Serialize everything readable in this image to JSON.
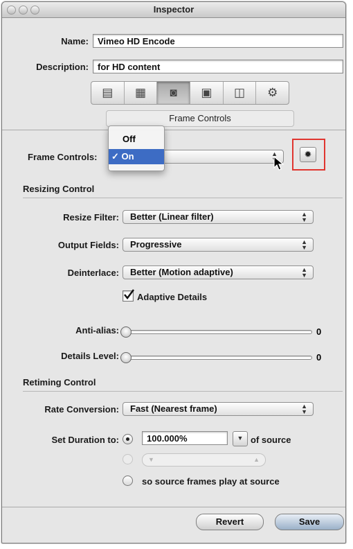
{
  "window": {
    "title": "Inspector"
  },
  "header": {
    "name_label": "Name:",
    "name_value": "Vimeo HD Encode",
    "description_label": "Description:",
    "description_value": "for HD content"
  },
  "toolbar": {
    "tabs": [
      {
        "icon": "summary-icon"
      },
      {
        "icon": "film-icon"
      },
      {
        "icon": "frame-controls-icon",
        "active": true
      },
      {
        "icon": "layers-icon"
      },
      {
        "icon": "geometry-icon"
      },
      {
        "icon": "gear-icon"
      }
    ],
    "caption": "Frame Controls"
  },
  "frame_controls": {
    "label": "Frame Controls:",
    "menu": {
      "items": [
        {
          "label": "Off",
          "checked": false
        },
        {
          "label": "On",
          "checked": true
        }
      ],
      "check_mark": "✓"
    },
    "settings_button": "gear-icon",
    "highlight_color": "#e0352f"
  },
  "resizing": {
    "heading": "Resizing Control",
    "resize_filter_label": "Resize Filter:",
    "resize_filter_value": "Better (Linear filter)",
    "output_fields_label": "Output Fields:",
    "output_fields_value": "Progressive",
    "deinterlace_label": "Deinterlace:",
    "deinterlace_value": "Better (Motion adaptive)",
    "adaptive_details_label": "Adaptive Details",
    "adaptive_details_checked": true,
    "anti_alias_label": "Anti-alias:",
    "anti_alias_value": "0",
    "details_level_label": "Details Level:",
    "details_level_value": "0"
  },
  "retiming": {
    "heading": "Retiming  Control",
    "rate_conversion_label": "Rate Conversion:",
    "rate_conversion_value": "Fast (Nearest frame)",
    "set_duration_label": "Set Duration to:",
    "duration_value": "100.000%",
    "of_source_label": "of source",
    "source_frames_label": "so source frames play at source"
  },
  "footer": {
    "revert_label": "Revert",
    "save_label": "Save"
  },
  "colors": {
    "selection": "#3d6cc4",
    "window_bg": "#e6e6e6"
  }
}
